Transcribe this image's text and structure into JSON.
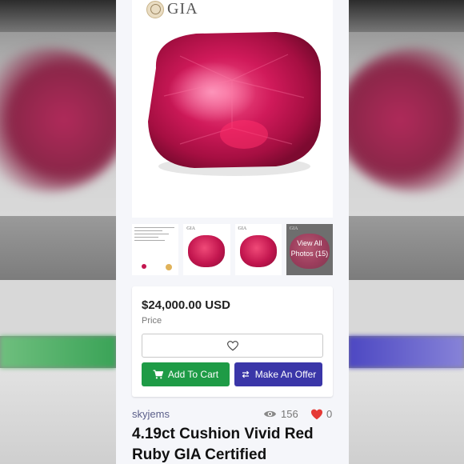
{
  "brand": {
    "logo_text": "GIA"
  },
  "gallery": {
    "thumbnails": [
      {
        "name": "certificate"
      },
      {
        "name": "gem-front",
        "logo_text": "GIA"
      },
      {
        "name": "gem-angle",
        "logo_text": "GIA"
      },
      {
        "name": "view-all",
        "logo_text": "GIA",
        "label_line1": "View All",
        "label_line2": "Photos (15)"
      }
    ]
  },
  "listing": {
    "price": "$24,000.00 USD",
    "price_label": "Price",
    "favorite_icon": "heart-outline-icon",
    "add_to_cart_label": "Add To Cart",
    "make_offer_label": "Make An Offer",
    "seller": "skyjems",
    "views": "156",
    "likes": "0",
    "title": "4.19ct Cushion Vivid Red Ruby GIA Certified"
  },
  "colors": {
    "add_to_cart": "#1e9b46",
    "make_offer": "#3a36a8",
    "like_heart": "#e53935",
    "seller_link": "#5b5f8a"
  }
}
